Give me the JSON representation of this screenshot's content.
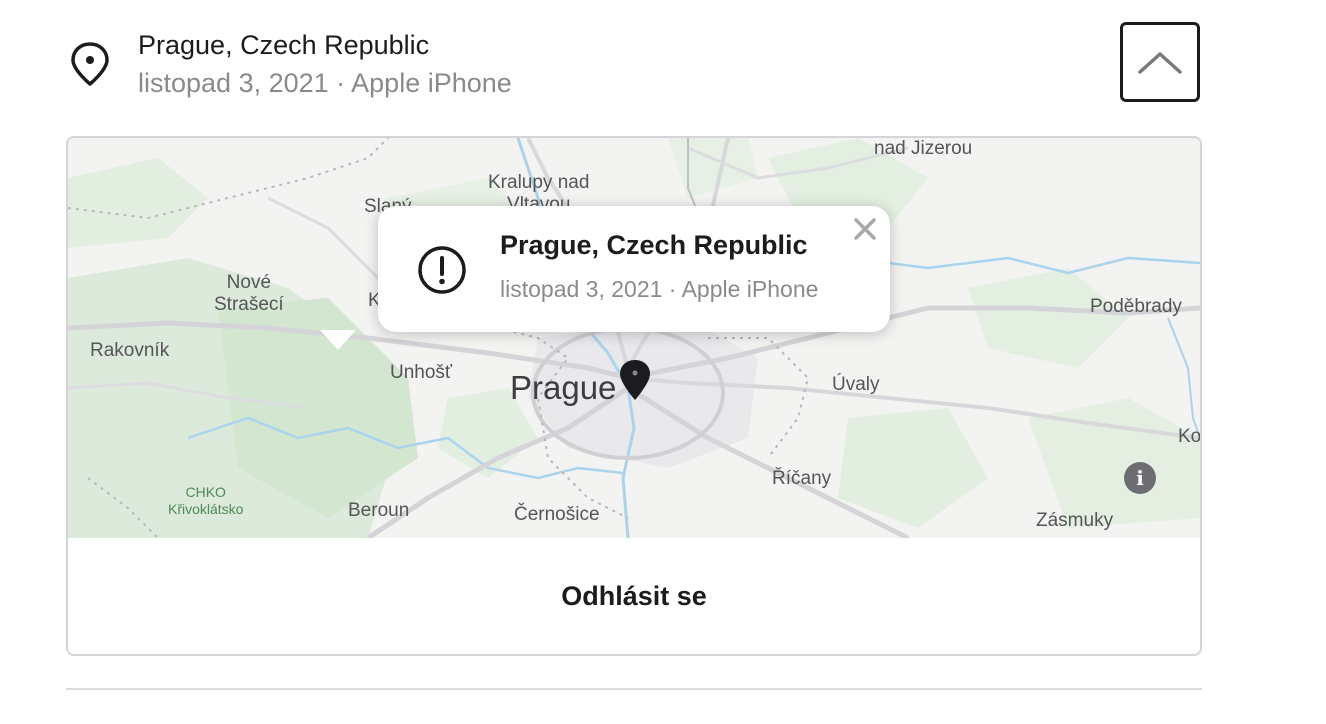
{
  "header": {
    "location": "Prague, Czech Republic",
    "details": "listopad 3, 2021 · Apple iPhone"
  },
  "map": {
    "labels": {
      "nad_jizerou": "nad Jizerou",
      "kralupy": "Kralupy nad\nVltavou",
      "slany": "Slaný",
      "nove_straseci": "Nové\nStrašecí",
      "kladno": "K",
      "rakovnik": "Rakovník",
      "unhost": "Unhošť",
      "prague": "Prague",
      "uvaly": "Úvaly",
      "podebrady": "Poděbrady",
      "kolin": "Ko",
      "ricany": "Říčany",
      "chko": "CHKO\nKřivoklátsko",
      "beroun": "Beroun",
      "cernosice": "Černošice",
      "zasmuky": "Zásmuky"
    },
    "popup": {
      "title": "Prague, Czech Republic",
      "details": "listopad 3, 2021 · Apple iPhone"
    }
  },
  "actions": {
    "sign_out": "Odhlásit se"
  }
}
